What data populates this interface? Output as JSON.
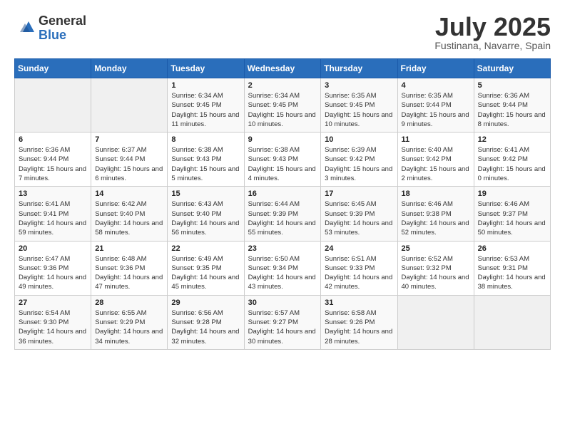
{
  "logo": {
    "general": "General",
    "blue": "Blue"
  },
  "title": "July 2025",
  "location": "Fustinana, Navarre, Spain",
  "weekdays": [
    "Sunday",
    "Monday",
    "Tuesday",
    "Wednesday",
    "Thursday",
    "Friday",
    "Saturday"
  ],
  "weeks": [
    [
      {
        "day": "",
        "sunrise": "",
        "sunset": "",
        "daylight": ""
      },
      {
        "day": "",
        "sunrise": "",
        "sunset": "",
        "daylight": ""
      },
      {
        "day": "1",
        "sunrise": "Sunrise: 6:34 AM",
        "sunset": "Sunset: 9:45 PM",
        "daylight": "Daylight: 15 hours and 11 minutes."
      },
      {
        "day": "2",
        "sunrise": "Sunrise: 6:34 AM",
        "sunset": "Sunset: 9:45 PM",
        "daylight": "Daylight: 15 hours and 10 minutes."
      },
      {
        "day": "3",
        "sunrise": "Sunrise: 6:35 AM",
        "sunset": "Sunset: 9:45 PM",
        "daylight": "Daylight: 15 hours and 10 minutes."
      },
      {
        "day": "4",
        "sunrise": "Sunrise: 6:35 AM",
        "sunset": "Sunset: 9:44 PM",
        "daylight": "Daylight: 15 hours and 9 minutes."
      },
      {
        "day": "5",
        "sunrise": "Sunrise: 6:36 AM",
        "sunset": "Sunset: 9:44 PM",
        "daylight": "Daylight: 15 hours and 8 minutes."
      }
    ],
    [
      {
        "day": "6",
        "sunrise": "Sunrise: 6:36 AM",
        "sunset": "Sunset: 9:44 PM",
        "daylight": "Daylight: 15 hours and 7 minutes."
      },
      {
        "day": "7",
        "sunrise": "Sunrise: 6:37 AM",
        "sunset": "Sunset: 9:44 PM",
        "daylight": "Daylight: 15 hours and 6 minutes."
      },
      {
        "day": "8",
        "sunrise": "Sunrise: 6:38 AM",
        "sunset": "Sunset: 9:43 PM",
        "daylight": "Daylight: 15 hours and 5 minutes."
      },
      {
        "day": "9",
        "sunrise": "Sunrise: 6:38 AM",
        "sunset": "Sunset: 9:43 PM",
        "daylight": "Daylight: 15 hours and 4 minutes."
      },
      {
        "day": "10",
        "sunrise": "Sunrise: 6:39 AM",
        "sunset": "Sunset: 9:42 PM",
        "daylight": "Daylight: 15 hours and 3 minutes."
      },
      {
        "day": "11",
        "sunrise": "Sunrise: 6:40 AM",
        "sunset": "Sunset: 9:42 PM",
        "daylight": "Daylight: 15 hours and 2 minutes."
      },
      {
        "day": "12",
        "sunrise": "Sunrise: 6:41 AM",
        "sunset": "Sunset: 9:42 PM",
        "daylight": "Daylight: 15 hours and 0 minutes."
      }
    ],
    [
      {
        "day": "13",
        "sunrise": "Sunrise: 6:41 AM",
        "sunset": "Sunset: 9:41 PM",
        "daylight": "Daylight: 14 hours and 59 minutes."
      },
      {
        "day": "14",
        "sunrise": "Sunrise: 6:42 AM",
        "sunset": "Sunset: 9:40 PM",
        "daylight": "Daylight: 14 hours and 58 minutes."
      },
      {
        "day": "15",
        "sunrise": "Sunrise: 6:43 AM",
        "sunset": "Sunset: 9:40 PM",
        "daylight": "Daylight: 14 hours and 56 minutes."
      },
      {
        "day": "16",
        "sunrise": "Sunrise: 6:44 AM",
        "sunset": "Sunset: 9:39 PM",
        "daylight": "Daylight: 14 hours and 55 minutes."
      },
      {
        "day": "17",
        "sunrise": "Sunrise: 6:45 AM",
        "sunset": "Sunset: 9:39 PM",
        "daylight": "Daylight: 14 hours and 53 minutes."
      },
      {
        "day": "18",
        "sunrise": "Sunrise: 6:46 AM",
        "sunset": "Sunset: 9:38 PM",
        "daylight": "Daylight: 14 hours and 52 minutes."
      },
      {
        "day": "19",
        "sunrise": "Sunrise: 6:46 AM",
        "sunset": "Sunset: 9:37 PM",
        "daylight": "Daylight: 14 hours and 50 minutes."
      }
    ],
    [
      {
        "day": "20",
        "sunrise": "Sunrise: 6:47 AM",
        "sunset": "Sunset: 9:36 PM",
        "daylight": "Daylight: 14 hours and 49 minutes."
      },
      {
        "day": "21",
        "sunrise": "Sunrise: 6:48 AM",
        "sunset": "Sunset: 9:36 PM",
        "daylight": "Daylight: 14 hours and 47 minutes."
      },
      {
        "day": "22",
        "sunrise": "Sunrise: 6:49 AM",
        "sunset": "Sunset: 9:35 PM",
        "daylight": "Daylight: 14 hours and 45 minutes."
      },
      {
        "day": "23",
        "sunrise": "Sunrise: 6:50 AM",
        "sunset": "Sunset: 9:34 PM",
        "daylight": "Daylight: 14 hours and 43 minutes."
      },
      {
        "day": "24",
        "sunrise": "Sunrise: 6:51 AM",
        "sunset": "Sunset: 9:33 PM",
        "daylight": "Daylight: 14 hours and 42 minutes."
      },
      {
        "day": "25",
        "sunrise": "Sunrise: 6:52 AM",
        "sunset": "Sunset: 9:32 PM",
        "daylight": "Daylight: 14 hours and 40 minutes."
      },
      {
        "day": "26",
        "sunrise": "Sunrise: 6:53 AM",
        "sunset": "Sunset: 9:31 PM",
        "daylight": "Daylight: 14 hours and 38 minutes."
      }
    ],
    [
      {
        "day": "27",
        "sunrise": "Sunrise: 6:54 AM",
        "sunset": "Sunset: 9:30 PM",
        "daylight": "Daylight: 14 hours and 36 minutes."
      },
      {
        "day": "28",
        "sunrise": "Sunrise: 6:55 AM",
        "sunset": "Sunset: 9:29 PM",
        "daylight": "Daylight: 14 hours and 34 minutes."
      },
      {
        "day": "29",
        "sunrise": "Sunrise: 6:56 AM",
        "sunset": "Sunset: 9:28 PM",
        "daylight": "Daylight: 14 hours and 32 minutes."
      },
      {
        "day": "30",
        "sunrise": "Sunrise: 6:57 AM",
        "sunset": "Sunset: 9:27 PM",
        "daylight": "Daylight: 14 hours and 30 minutes."
      },
      {
        "day": "31",
        "sunrise": "Sunrise: 6:58 AM",
        "sunset": "Sunset: 9:26 PM",
        "daylight": "Daylight: 14 hours and 28 minutes."
      },
      {
        "day": "",
        "sunrise": "",
        "sunset": "",
        "daylight": ""
      },
      {
        "day": "",
        "sunrise": "",
        "sunset": "",
        "daylight": ""
      }
    ]
  ]
}
